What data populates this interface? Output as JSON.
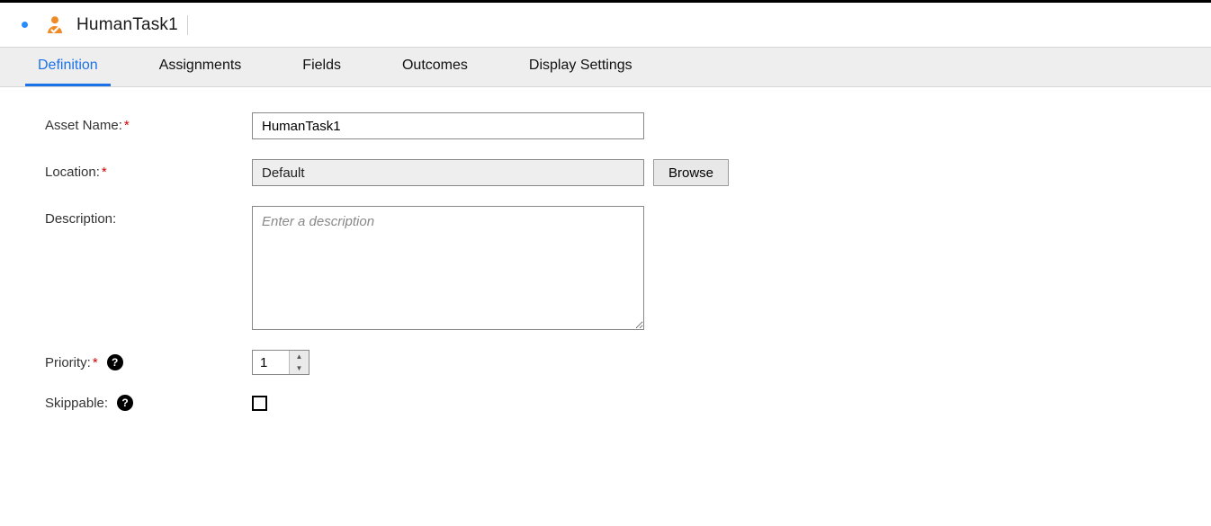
{
  "header": {
    "title": "HumanTask1",
    "modified": true
  },
  "tabs": [
    {
      "id": "definition",
      "label": "Definition",
      "active": true
    },
    {
      "id": "assignments",
      "label": "Assignments",
      "active": false
    },
    {
      "id": "fields",
      "label": "Fields",
      "active": false
    },
    {
      "id": "outcomes",
      "label": "Outcomes",
      "active": false
    },
    {
      "id": "display-settings",
      "label": "Display Settings",
      "active": false
    }
  ],
  "form": {
    "asset_name": {
      "label": "Asset Name:",
      "value": "HumanTask1",
      "required": true
    },
    "location": {
      "label": "Location:",
      "value": "Default",
      "required": true,
      "browse_label": "Browse"
    },
    "description": {
      "label": "Description:",
      "value": "",
      "placeholder": "Enter a description",
      "required": false
    },
    "priority": {
      "label": "Priority:",
      "value": "1",
      "required": true
    },
    "skippable": {
      "label": "Skippable:",
      "checked": false
    }
  },
  "icons": {
    "help": "?"
  }
}
